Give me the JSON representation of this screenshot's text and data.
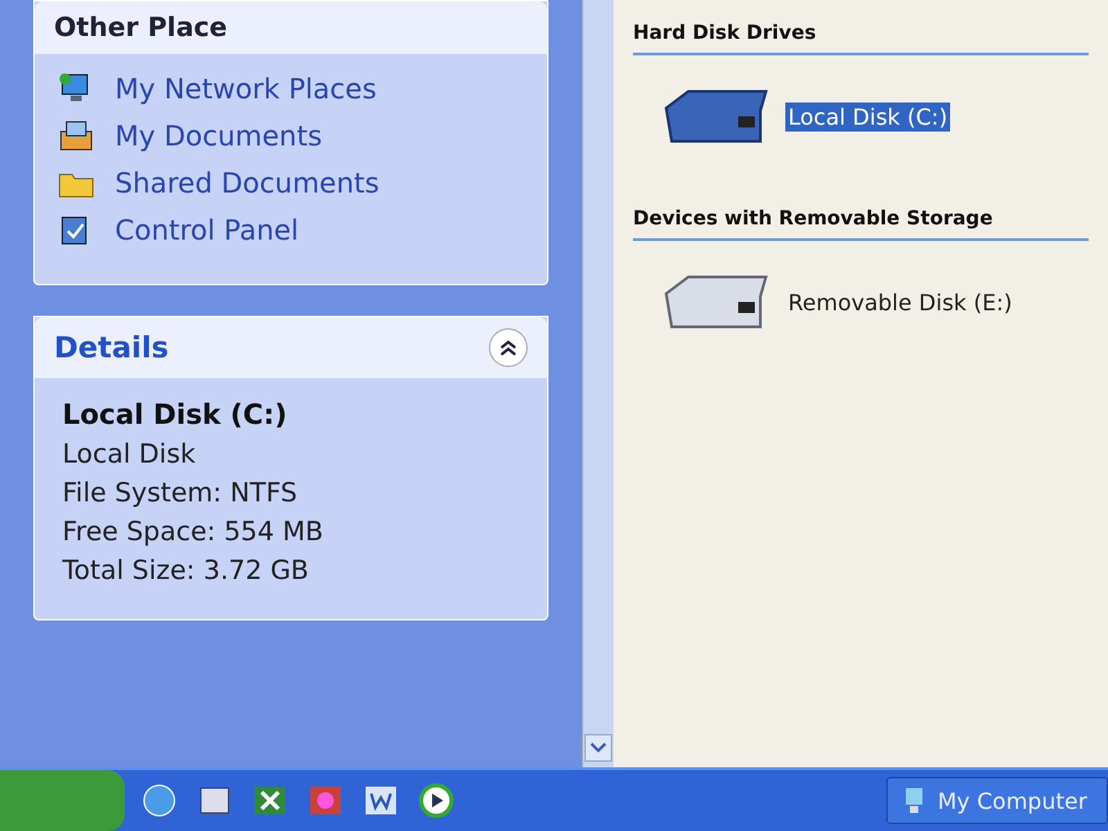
{
  "other_places": {
    "title": "Other Place",
    "items": [
      {
        "label": "My Network Places",
        "kind": "network"
      },
      {
        "label": "My Documents",
        "kind": "documents"
      },
      {
        "label": "Shared Documents",
        "kind": "folder"
      },
      {
        "label": "Control Panel",
        "kind": "control"
      }
    ]
  },
  "details": {
    "title": "Details",
    "expanded": true,
    "name": "Local Disk (C:)",
    "lines": [
      "Local Disk",
      "File System: NTFS",
      "Free Space: 554 MB",
      "Total Size: 3.72 GB"
    ]
  },
  "sections": [
    {
      "title": "Hard Disk Drives",
      "items": [
        {
          "label": "Local Disk (C:)",
          "kind": "hdd",
          "selected": true
        }
      ]
    },
    {
      "title": "Devices with Removable Storage",
      "items": [
        {
          "label": "Removable Disk (E:)",
          "kind": "removable",
          "selected": false
        }
      ]
    }
  ],
  "taskbar": {
    "quick_launch": [
      {
        "kind": "browser"
      },
      {
        "kind": "mail"
      },
      {
        "kind": "sheet"
      },
      {
        "kind": "slides"
      },
      {
        "kind": "writer"
      },
      {
        "kind": "player"
      }
    ],
    "tasks": [
      {
        "label": "My Computer",
        "selected": false
      }
    ]
  }
}
